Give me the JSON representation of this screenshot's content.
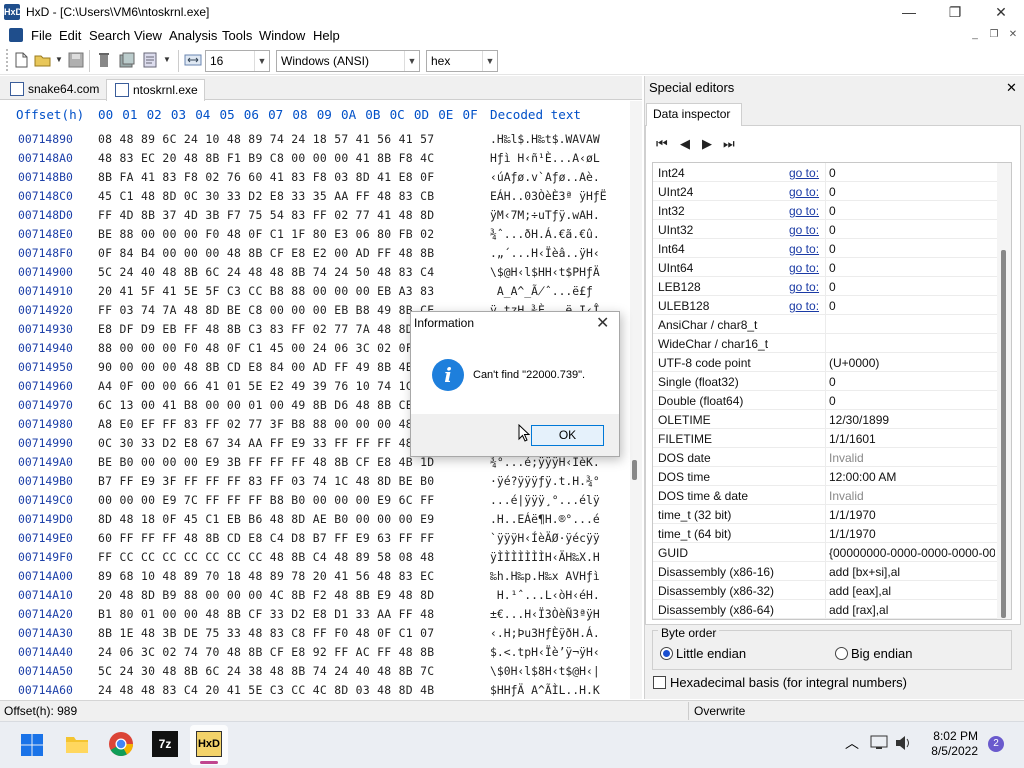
{
  "window": {
    "app_icon": "HxD",
    "title": "HxD - [C:\\Users\\VM6\\ntoskrnl.exe]",
    "minimize": "—",
    "maximize": "❐",
    "close": "✕"
  },
  "menu": [
    "File",
    "Edit",
    "Search",
    "View",
    "Analysis",
    "Tools",
    "Window",
    "Help"
  ],
  "mdi_controls": [
    "_",
    "❐",
    "✕"
  ],
  "toolbar": {
    "bytes_per_row": "16",
    "charset": "Windows (ANSI)",
    "offset_base": "hex",
    "icons": [
      "new-file-icon",
      "open-file-icon",
      "dropdown-arrow-icon",
      "save-icon",
      "trash-icon",
      "save-all-icon",
      "properties-icon",
      "dropdown-arrow-icon",
      "columns-icon"
    ]
  },
  "tabs": [
    {
      "label": "snake64.com",
      "active": false
    },
    {
      "label": "ntoskrnl.exe",
      "active": true
    }
  ],
  "hex_header": {
    "offset": "Offset(h)",
    "columns": [
      "00",
      "01",
      "02",
      "03",
      "04",
      "05",
      "06",
      "07",
      "08",
      "09",
      "0A",
      "0B",
      "0C",
      "0D",
      "0E",
      "0F"
    ],
    "decoded": "Decoded text"
  },
  "hex_rows": [
    {
      "offset": "00714890",
      "hex": "08 48 89 6C 24 10 48 89 74 24 18 57 41 56 41 57",
      "text": ".H‰l$.H‰t$.WAVAW"
    },
    {
      "offset": "007148A0",
      "hex": "48 83 EC 20 48 8B F1 B9 C8 00 00 00 41 8B F8 4C",
      "text": "Hƒì H‹ñ¹È...A‹øL"
    },
    {
      "offset": "007148B0",
      "hex": "8B FA 41 83 F8 02 76 60 41 83 F8 03 8D 41 E8 0F",
      "text": "‹úAƒø.v`Aƒø..Aè."
    },
    {
      "offset": "007148C0",
      "hex": "45 C1 48 8D 0C 30 33 D2 E8 33 35 AA FF 48 83 CB",
      "text": "EÁH..03ÒèÈ3ª ÿHƒË"
    },
    {
      "offset": "007148D0",
      "hex": "FF 4D 8B 37 4D 3B F7 75 54 83 FF 02 77 41 48 8D",
      "text": "ÿM‹7M;÷uTƒÿ.wAH."
    },
    {
      "offset": "007148E0",
      "hex": "BE 88 00 00 00 F0 48 0F C1 1F 80 E3 06 80 FB 02",
      "text": "¾ˆ...ðH.Á.€ã.€û."
    },
    {
      "offset": "007148F0",
      "hex": "0F 84 B4 00 00 00 48 8B CF E8 E2 00 AD FF 48 8B",
      "text": ".„´...H‹Ïèâ..ÿH‹"
    },
    {
      "offset": "00714900",
      "hex": "5C 24 40 48 8B 6C 24 48 48 8B 74 24 50 48 83 C4",
      "text": "\\$@H‹l$HH‹t$PHƒÄ"
    },
    {
      "offset": "00714910",
      "hex": "20 41 5F 41 5E 5F C3 CC B8 88 00 00 00 EB A3 83",
      "text": " A_A^_Ã̸ˆ...ë£ƒ"
    },
    {
      "offset": "00714920",
      "hex": "FF 03 74 7A 48 8D BE C8 00 00 00 EB B8 49 8B CE",
      "text": "ÿ.tzH.¾È...ë¸I‹Î"
    },
    {
      "offset": "00714930",
      "hex": "E8 DF D9 EB FF 48 8B C3 83 FF 02 77 7A 48 8D AE",
      "text": "èßÙëÿH‹Ãƒÿ.wzH.®"
    },
    {
      "offset": "00714940",
      "hex": "88 00 00 00 F0 48 0F C1 45 00 24 06 3C 02 0F 85",
      "text": "ˆ...ðH.ÁE.$.<..…"
    },
    {
      "offset": "00714950",
      "hex": "90 00 00 00 48 8B CD E8 84 00 AD FF 49 8B 4E 48",
      "text": "....H‹Íè„..ÿI‹NH"
    },
    {
      "offset": "00714960",
      "hex": "A4 0F 00 00 66 41 01 5E E2 49 39 76 10 74 1C 48",
      "text": "¤...fA.^âI9v.t.H"
    },
    {
      "offset": "00714970",
      "hex": "6C 13 00 41 B8 00 00 01 00 49 8B D6 48 8B CE E8",
      "text": "l..A¸....I‹ÖH‹Îè"
    },
    {
      "offset": "00714980",
      "hex": "A8 E0 EF FF 83 FF 02 77 3F B8 88 00 00 00 48 8B",
      "text": "¨àïÿƒÿ.w?¸ˆ...H‹"
    },
    {
      "offset": "00714990",
      "hex": "0C 30 33 D2 E8 67 34 AA FF E9 33 FF FF FF 48 8B",
      "text": ".03ÒègX4ªÿé3ÿÿÿH‹"
    },
    {
      "offset": "007149A0",
      "hex": "BE B0 00 00 00 E9 3B FF FF FF 48 8B CF E8 4B 1D",
      "text": "¾°...é;ÿÿÿH‹ÏèK."
    },
    {
      "offset": "007149B0",
      "hex": "B7 FF E9 3F FF FF FF 83 FF 03 74 1C 48 8D BE B0",
      "text": "·ÿé?ÿÿÿƒÿ.t.H.¾°"
    },
    {
      "offset": "007149C0",
      "hex": "00 00 00 E9 7C FF FF FF B8 B0 00 00 00 E9 6C FF",
      "text": "...é|ÿÿÿ¸°...élÿ"
    },
    {
      "offset": "007149D0",
      "hex": "8D 48 18 0F 45 C1 EB B6 48 8D AE B0 00 00 00 E9",
      "text": ".H..EÁë¶H.®°...é"
    },
    {
      "offset": "007149E0",
      "hex": "60 FF FF FF 48 8B CD E8 C4 D8 B7 FF E9 63 FF FF",
      "text": "`ÿÿÿH‹ÍèÄØ·ÿécÿÿ"
    },
    {
      "offset": "007149F0",
      "hex": "FF CC CC CC CC CC CC CC 48 8B C4 48 89 58 08 48",
      "text": "ÿÌÌÌÌÌÌÌH‹ÄH‰X.H"
    },
    {
      "offset": "00714A00",
      "hex": "89 68 10 48 89 70 18 48 89 78 20 41 56 48 83 EC",
      "text": "‰h.H‰p.H‰x AVHƒì"
    },
    {
      "offset": "00714A10",
      "hex": "20 48 8D B9 88 00 00 00 4C 8B F2 48 8B E9 48 8D",
      "text": " H.¹ˆ...L‹òH‹éH."
    },
    {
      "offset": "00714A20",
      "hex": "B1 80 01 00 00 48 8B CF 33 D2 E8 D1 33 AA FF 48",
      "text": "±€...H‹Ï3ÒèÑ3ªÿH"
    },
    {
      "offset": "00714A30",
      "hex": "8B 1E 48 3B DE 75 33 48 83 C8 FF F0 48 0F C1 07",
      "text": "‹.H;Þu3HƒÈÿðH.Á."
    },
    {
      "offset": "00714A40",
      "hex": "24 06 3C 02 74 70 48 8B CF E8 92 FF AC FF 48 8B",
      "text": "$.<.tpH‹Ïè’ÿ¬ÿH‹"
    },
    {
      "offset": "00714A50",
      "hex": "5C 24 30 48 8B 6C 24 38 48 8B 74 24 40 48 8B 7C",
      "text": "\\$0H‹l$8H‹t$@H‹|"
    },
    {
      "offset": "00714A60",
      "hex": "24 48 48 83 C4 20 41 5E C3 CC 4C 8D 03 48 8D 4B",
      "text": "$HHƒÄ A^ÃÌL..H.K"
    },
    {
      "offset": "00714A70",
      "hex": "B0 48 8B 1B 4D 85 F6 0F 85 49 6B 13 00 0F BA 71",
      "text": "°H‹.M…ö.…Ik...ºq"
    },
    {
      "offset": "00714A80",
      "hex": "28 10 49 8B 50 08 49 8B 00 48 89 02 49 8B 10 49",
      "text": "(.I‹P.I‹.H‰.I‹.I"
    },
    {
      "offset": "00714A90",
      "hex": "8B 40 08 48 89 42 08 BA 01 00 00 00 FF 8D D0 01",
      "text": "‹@.H‰B.º....ÿ.Ð."
    },
    {
      "offset": "00714AA0",
      "hex": "00 00 48 83 61 38 00 48 83 61 40 00 E8 8F 1A 00",
      "text": "..Hƒa8.Hƒa@.è..."
    },
    {
      "offset": "00714AB0",
      "hex": "00 E9 7C FF FF FF 48 8B CF E8 F2 D7 B7 FF EB 86",
      "text": ".é|ÿÿÿH‹Ïèò×·ÿë†"
    }
  ],
  "special_editors": {
    "title": "Special editors",
    "close": "✕",
    "tab": "Data inspector",
    "nav": [
      "⏮",
      "◀",
      "▶",
      "⏭"
    ],
    "rows": [
      {
        "label": "Int24",
        "goto": "go to:",
        "value": "0"
      },
      {
        "label": "UInt24",
        "goto": "go to:",
        "value": "0"
      },
      {
        "label": "Int32",
        "goto": "go to:",
        "value": "0"
      },
      {
        "label": "UInt32",
        "goto": "go to:",
        "value": "0"
      },
      {
        "label": "Int64",
        "goto": "go to:",
        "value": "0"
      },
      {
        "label": "UInt64",
        "goto": "go to:",
        "value": "0"
      },
      {
        "label": "LEB128",
        "goto": "go to:",
        "value": "0"
      },
      {
        "label": "ULEB128",
        "goto": "go to:",
        "value": "0"
      },
      {
        "label": "AnsiChar / char8_t",
        "goto": "",
        "value": ""
      },
      {
        "label": "WideChar / char16_t",
        "goto": "",
        "value": ""
      },
      {
        "label": "UTF-8 code point",
        "goto": "",
        "value": " (U+0000)"
      },
      {
        "label": "Single (float32)",
        "goto": "",
        "value": "0"
      },
      {
        "label": "Double (float64)",
        "goto": "",
        "value": "0"
      },
      {
        "label": "OLETIME",
        "goto": "",
        "value": "12/30/1899"
      },
      {
        "label": "FILETIME",
        "goto": "",
        "value": "1/1/1601"
      },
      {
        "label": "DOS date",
        "goto": "",
        "value": "Invalid",
        "gray": true
      },
      {
        "label": "DOS time",
        "goto": "",
        "value": "12:00:00 AM"
      },
      {
        "label": "DOS time & date",
        "goto": "",
        "value": "Invalid",
        "gray": true
      },
      {
        "label": "time_t (32 bit)",
        "goto": "",
        "value": "1/1/1970"
      },
      {
        "label": "time_t (64 bit)",
        "goto": "",
        "value": "1/1/1970"
      },
      {
        "label": "GUID",
        "goto": "",
        "value": "{00000000-0000-0000-0000-000000000000}"
      },
      {
        "label": "Disassembly (x86-16)",
        "goto": "",
        "value": "add [bx+si],al"
      },
      {
        "label": "Disassembly (x86-32)",
        "goto": "",
        "value": "add [eax],al"
      },
      {
        "label": "Disassembly (x86-64)",
        "goto": "",
        "value": "add [rax],al"
      }
    ],
    "byte_order_label": "Byte order",
    "little_endian": "Little endian",
    "big_endian": "Big endian",
    "hex_basis": "Hexadecimal basis (for integral numbers)"
  },
  "status": {
    "offset": "Offset(h): 989",
    "mode": "Overwrite"
  },
  "dialog": {
    "title": "Information",
    "close": "✕",
    "icon": "i",
    "message": "Can't find \"22000.739\".",
    "ok": "OK"
  },
  "taskbar": {
    "time": "8:02 PM",
    "date": "8/5/2022",
    "notifications": "2",
    "apps": [
      "windows-start-icon",
      "file-explorer-icon",
      "chrome-icon",
      "7zip-icon",
      "hxd-icon"
    ],
    "tray": [
      "chevron-up-icon",
      "network-icon",
      "volume-icon"
    ],
    "seven_zip_label": "7z"
  }
}
